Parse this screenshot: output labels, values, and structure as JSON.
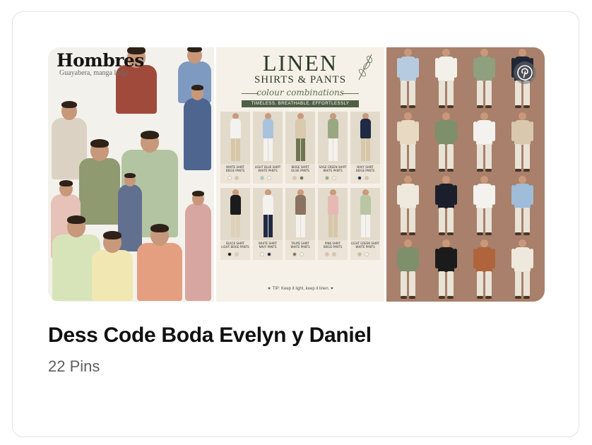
{
  "board": {
    "title": "Dess Code Boda Evelyn y Daniel",
    "pin_count": "22 Pins"
  },
  "collage": {
    "left": {
      "heading": "Hombres",
      "subheading": "Guayabera, manga larga"
    },
    "middle": {
      "title": "LINEN",
      "subtitle": "SHIRTS & PANTS",
      "script": "colour combinations",
      "banner": "TIMELESS. BREATHABLE. EFFORTLESSLY STYLISH.",
      "tiles": [
        {
          "label": "WHITE SHIRT\nBEIGE PANTS",
          "shirt": "#f4f2ee",
          "pants": "#d7c7a8",
          "swatches": [
            "#f4f2ee",
            "#d7c7a8"
          ]
        },
        {
          "label": "LIGHT BLUE SHIRT\nWHITE PANTS",
          "shirt": "#a9c3dc",
          "pants": "#f4f2ee",
          "swatches": [
            "#a9c3dc",
            "#f4f2ee"
          ]
        },
        {
          "label": "BEIGE SHIRT\nOLIVE PANTS",
          "shirt": "#d9c9ad",
          "pants": "#6f7550",
          "swatches": [
            "#d9c9ad",
            "#6f7550"
          ]
        },
        {
          "label": "SAGE GREEN SHIRT\nWHITE PANTS",
          "shirt": "#9aa882",
          "pants": "#f4f2ee",
          "swatches": [
            "#9aa882",
            "#f4f2ee"
          ]
        },
        {
          "label": "NAVY SHIRT\nBEIGE PANTS",
          "shirt": "#1f2a44",
          "pants": "#d7c7a8",
          "swatches": [
            "#1f2a44",
            "#d7c7a8"
          ]
        },
        {
          "label": "BLACK SHIRT\nLIGHT BEIGE PANTS",
          "shirt": "#1b1b1b",
          "pants": "#ddd1ba",
          "swatches": [
            "#1b1b1b",
            "#ddd1ba"
          ]
        },
        {
          "label": "WHITE SHIRT\nNAVY PANTS",
          "shirt": "#f4f2ee",
          "pants": "#1f2a44",
          "swatches": [
            "#f4f2ee",
            "#1f2a44"
          ]
        },
        {
          "label": "TAUPE SHIRT\nWHITE PANTS",
          "shirt": "#8a7360",
          "pants": "#f4f2ee",
          "swatches": [
            "#8a7360",
            "#f4f2ee"
          ]
        },
        {
          "label": "PINK SHIRT\nBEIGE PANTS",
          "shirt": "#e7b9b5",
          "pants": "#d7c7a8",
          "swatches": [
            "#e7b9b5",
            "#d7c7a8"
          ]
        },
        {
          "label": "LIGHT GREEN SHIRT\nWHITE PANTS",
          "shirt": "#b9c6a3",
          "pants": "#f4f2ee",
          "swatches": [
            "#b9c6a3",
            "#f4f2ee"
          ]
        }
      ],
      "tip": "TIP: Keep it light, keep it linen."
    }
  },
  "icons": {
    "pinterest": "pinterest-logo-icon",
    "leaf": "leaf-icon",
    "star": "star-icon",
    "heart": "heart-icon"
  },
  "colors": {
    "title_text": "#111111",
    "count_text": "#5f5f5f",
    "card_border": "#e2e2e2",
    "outfit_backdrop": "#a8806b"
  }
}
